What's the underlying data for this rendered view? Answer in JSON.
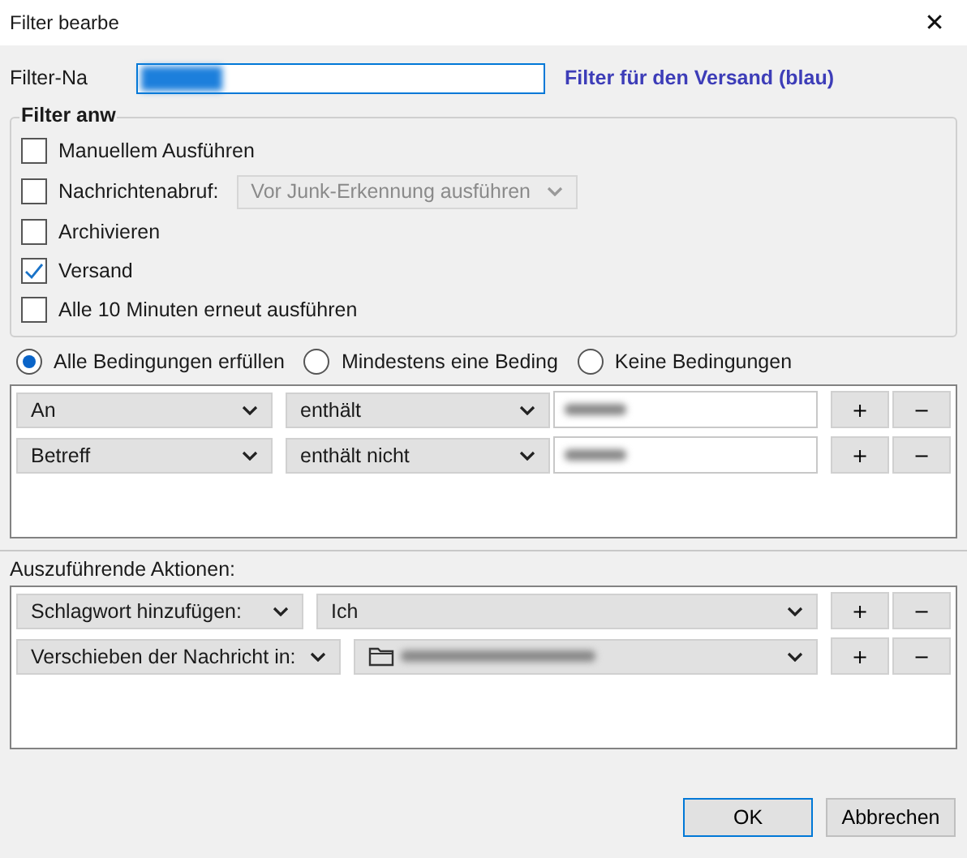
{
  "window": {
    "title": "Filter bearbe",
    "close": "✕"
  },
  "filter_name": {
    "label": "Filter-Na"
  },
  "description": "Filter für den Versand (blau)",
  "apply_group": {
    "title": "Filter anw",
    "options": [
      {
        "kind": "checkbox",
        "label": "Manuellem Ausführen",
        "checked": false
      },
      {
        "kind": "checkbox_dropdown",
        "label": "Nachrichtenabruf:",
        "checked": false,
        "dropdown": {
          "value": "Vor Junk-Erkennung ausführen",
          "disabled": true
        }
      },
      {
        "kind": "checkbox",
        "label": "Archivieren",
        "checked": false
      },
      {
        "kind": "checkbox",
        "label": "Versand",
        "checked": true
      },
      {
        "kind": "checkbox",
        "label": "Alle 10 Minuten erneut ausführen",
        "checked": false
      }
    ]
  },
  "match_modes": [
    {
      "label": "Alle Bedingungen erfüllen",
      "selected": true
    },
    {
      "label": "Mindestens eine Beding",
      "selected": false
    },
    {
      "label": "Keine Bedingungen",
      "selected": false
    }
  ],
  "conditions": [
    {
      "field": "An",
      "operator": "enthält",
      "add": "+",
      "remove": "−"
    },
    {
      "field": "Betreff",
      "operator": "enthält nicht",
      "add": "+",
      "remove": "−"
    }
  ],
  "actions_label": "Auszuführende Aktionen:",
  "actions": [
    {
      "action": "Schlagwort hinzufügen:",
      "kind": "tag",
      "target": "Ich",
      "add": "+",
      "remove": "−"
    },
    {
      "action": "Verschieben der Nachricht in:",
      "kind": "folder",
      "add": "+",
      "remove": "−"
    }
  ],
  "buttons": [
    {
      "label": "OK",
      "default": true
    },
    {
      "label": "Abbrechen",
      "default": false
    }
  ]
}
